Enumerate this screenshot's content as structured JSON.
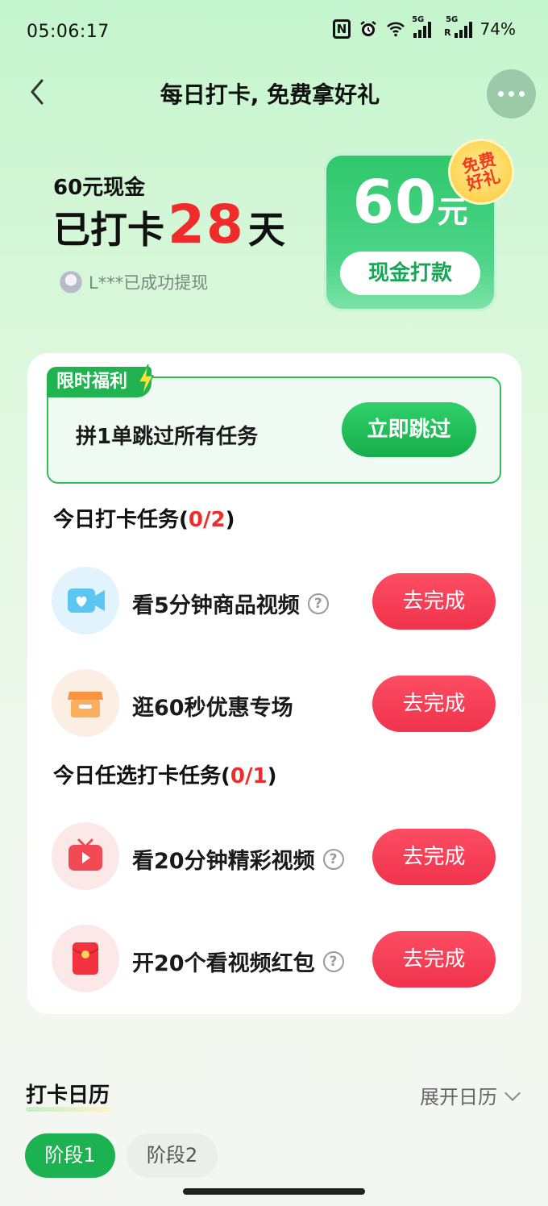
{
  "status_bar": {
    "time": "05:06:17",
    "battery": "74%",
    "network1": "5G",
    "network2": "5G",
    "roaming": "R"
  },
  "nav": {
    "title": "每日打卡, 免费拿好礼"
  },
  "hero": {
    "subtitle": "60元现金",
    "checkin_prefix": "已打卡",
    "checkin_days": "28",
    "checkin_suffix": "天",
    "user_notice": "L***已成功提现"
  },
  "cash_card": {
    "amount": "60",
    "unit": "元",
    "button_label": "现金打款",
    "badge": "免费好礼"
  },
  "promo": {
    "tag": "限时福利",
    "text": "拼1单跳过所有任务",
    "button_label": "立即跳过"
  },
  "section_today": {
    "title": "今日打卡任务(",
    "progress": "0/2",
    "close": ")"
  },
  "section_optional": {
    "title": "今日任选打卡任务(",
    "progress": "0/1",
    "close": ")"
  },
  "tasks": [
    {
      "label": "看5分钟商品视频",
      "help": "?",
      "button": "去完成",
      "icon": "video-camera-icon"
    },
    {
      "label": "逛60秒优惠专场",
      "help": "",
      "button": "去完成",
      "icon": "store-icon"
    },
    {
      "label": "看20分钟精彩视频",
      "help": "?",
      "button": "去完成",
      "icon": "tv-play-icon"
    },
    {
      "label": "开20个看视频红包",
      "help": "?",
      "button": "去完成",
      "icon": "red-envelope-icon"
    }
  ],
  "calendar": {
    "title": "打卡日历",
    "expand_label": "展开日历",
    "stages": [
      "阶段1",
      "阶段2"
    ]
  },
  "colors": {
    "accent_green": "#1db251",
    "accent_red": "#f0334b",
    "highlight_red": "#f02b2b"
  }
}
